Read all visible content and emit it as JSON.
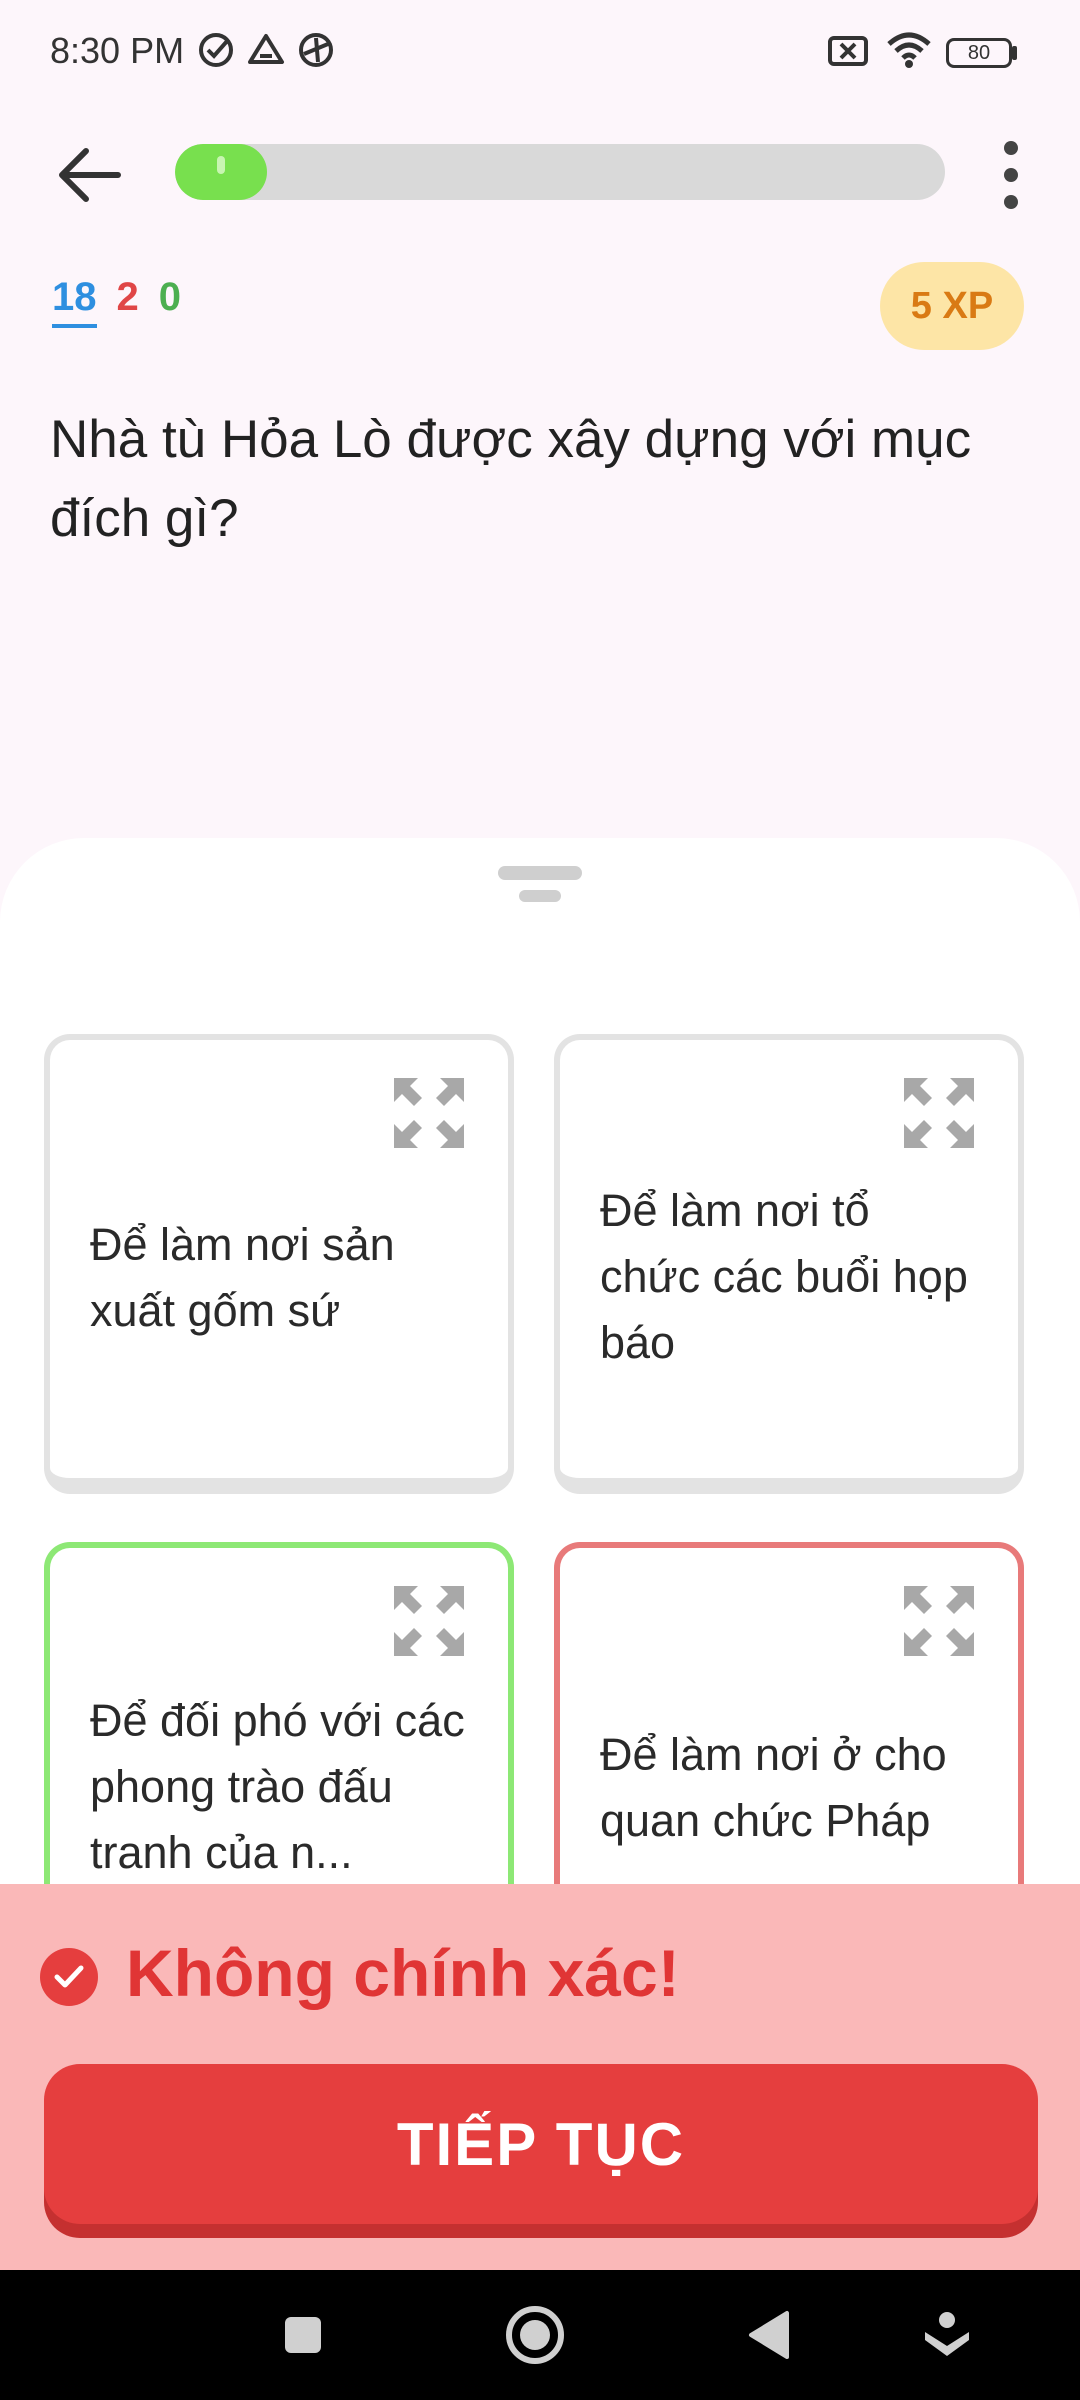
{
  "status_bar": {
    "time": "8:30 PM",
    "icons": [
      "check-circle-icon",
      "drive-icon",
      "vpn-icon",
      "no-sim-icon",
      "wifi-icon",
      "battery-icon"
    ],
    "battery": "80"
  },
  "header": {
    "back_icon": "arrow-left-icon",
    "progress_fraction": 0.12,
    "menu_icon": "more-vertical-icon"
  },
  "stats": {
    "total": "18",
    "wrong": "2",
    "correct": "0"
  },
  "xp_badge": "5 XP",
  "question": "Nhà tù Hỏa Lò được xây dựng với mục đích gì?",
  "answers": [
    {
      "text": "Để làm nơi sản xuất gốm sứ",
      "state": "neutral"
    },
    {
      "text": "Để làm nơi tổ chức các buổi họp báo",
      "state": "neutral"
    },
    {
      "text": "Để đối phó với các phong trào đấu tranh của n...",
      "state": "correct"
    },
    {
      "text": "Để làm nơi ở cho quan chức Pháp",
      "state": "wrong"
    }
  ],
  "feedback": {
    "message": "Không chính xác!",
    "icon": "check-circle-icon"
  },
  "continue_label": "TIẾP TỤC",
  "colors": {
    "progress": "#78e04e",
    "wrong": "#e53e3e",
    "correct_border": "#8de875",
    "wrong_border": "#e87a7a",
    "xp_bg": "#fde5a6",
    "xp_text": "#d97a14",
    "feedback_bg": "#fab8b8"
  },
  "nav_bar": [
    "recents-square-icon",
    "home-circle-icon",
    "back-triangle-icon",
    "assist-icon"
  ]
}
